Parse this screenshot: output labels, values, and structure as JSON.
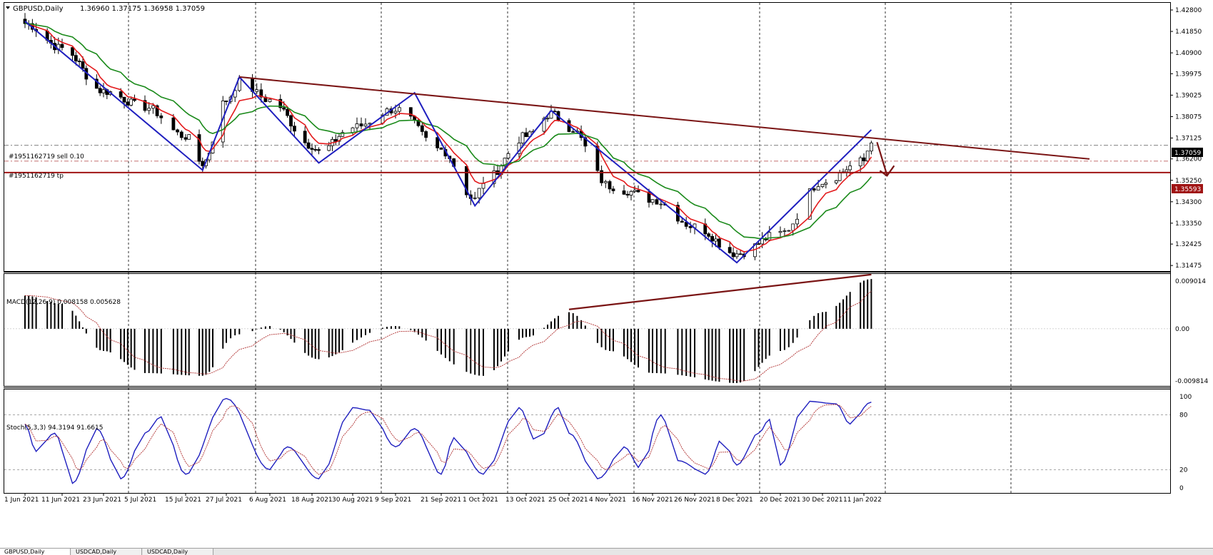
{
  "colors": {
    "candle_up": "#ffffff",
    "candle_down": "#000000",
    "ma_fast": "#e31a1c",
    "ma_slow": "#1a8a1a",
    "zigzag": "#1f1fbf",
    "trendline": "#7a1414",
    "support": "#a01414",
    "stoch_main": "#1f1fbf",
    "stoch_signal": "#b03030",
    "grid": "#000000"
  },
  "header": {
    "symbol_label": "GBPUSD,Daily",
    "ohlc_text": "1.36960 1.37175 1.36958 1.37059"
  },
  "orders": {
    "sell_label": "#1951162719 sell 0.10",
    "tp_label": "#1951162719 tp"
  },
  "price_tags": {
    "current": "1.37059",
    "support": "1.35593"
  },
  "price_axis_labels": [
    "1.42800",
    "1.41850",
    "1.40900",
    "1.39975",
    "1.39025",
    "1.38075",
    "1.37125",
    "1.36200",
    "1.35250",
    "1.34300",
    "1.33350",
    "1.32425",
    "1.31475"
  ],
  "macd": {
    "label": "MACD(12,26,9) 0.008158 0.005628",
    "axis_labels": [
      "0.009014",
      "0.00",
      "-0.009814"
    ]
  },
  "stoch": {
    "label": "Stoch(5,3,3) 94.3194 91.6615",
    "axis_labels": [
      "100",
      "80",
      "20",
      "0"
    ]
  },
  "date_labels": [
    "1 Jun 2021",
    "11 Jun 2021",
    "23 Jun 2021",
    "5 Jul 2021",
    "15 Jul 2021",
    "27 Jul 2021",
    "6 Aug 2021",
    "18 Aug 2021",
    "30 Aug 2021",
    "9 Sep 2021",
    "21 Sep 2021",
    "1 Oct 2021",
    "13 Oct 2021",
    "25 Oct 2021",
    "4 Nov 2021",
    "16 Nov 2021",
    "26 Nov 2021",
    "8 Dec 2021",
    "20 Dec 2021",
    "30 Dec 2021",
    "11 Jan 2022"
  ],
  "tabs": [
    "GBPUSD,Daily",
    "USDCAD,Daily",
    "USDCAD,Daily"
  ],
  "chart_data": {
    "type": "candlestick",
    "price_range": [
      1.3148,
      1.428
    ],
    "grid": true,
    "anchors": [
      {
        "date": "1 Jun 2021",
        "price": 1.422
      },
      {
        "date": "11 Jun 2021",
        "price": 1.411
      },
      {
        "date": "23 Jun 2021",
        "price": 1.392
      },
      {
        "date": "5 Jul 2021",
        "price": 1.385
      },
      {
        "date": "15 Jul 2021",
        "price": 1.372
      },
      {
        "date": "20 Jul 2021",
        "price": 1.36
      },
      {
        "date": "27 Jul 2021",
        "price": 1.388
      },
      {
        "date": "30 Jul 2021",
        "price": 1.396
      },
      {
        "date": "6 Aug 2021",
        "price": 1.388
      },
      {
        "date": "18 Aug 2021",
        "price": 1.368
      },
      {
        "date": "20 Aug 2021",
        "price": 1.365
      },
      {
        "date": "30 Aug 2021",
        "price": 1.376
      },
      {
        "date": "9 Sep 2021",
        "price": 1.384
      },
      {
        "date": "21 Sep 2021",
        "price": 1.366
      },
      {
        "date": "29 Sep 2021",
        "price": 1.344
      },
      {
        "date": "1 Oct 2021",
        "price": 1.352
      },
      {
        "date": "13 Oct 2021",
        "price": 1.372
      },
      {
        "date": "20 Oct 2021",
        "price": 1.382
      },
      {
        "date": "25 Oct 2021",
        "price": 1.376
      },
      {
        "date": "4 Nov 2021",
        "price": 1.35
      },
      {
        "date": "8 Nov 2021",
        "price": 1.348
      },
      {
        "date": "16 Nov 2021",
        "price": 1.344
      },
      {
        "date": "26 Nov 2021",
        "price": 1.332
      },
      {
        "date": "8 Dec 2021",
        "price": 1.32
      },
      {
        "date": "20 Dec 2021",
        "price": 1.329
      },
      {
        "date": "30 Dec 2021",
        "price": 1.352
      },
      {
        "date": "11 Jan 2022",
        "price": 1.361
      },
      {
        "date": "13 Jan 2022",
        "price": 1.3706
      }
    ],
    "zigzag": [
      {
        "date": "1 Jun 2021",
        "price": 1.423
      },
      {
        "date": "20 Jul 2021",
        "price": 1.357
      },
      {
        "date": "30 Jul 2021",
        "price": 1.3983
      },
      {
        "date": "20 Aug 2021",
        "price": 1.3602
      },
      {
        "date": "14 Sep 2021",
        "price": 1.3913
      },
      {
        "date": "29 Sep 2021",
        "price": 1.3412
      },
      {
        "date": "20 Oct 2021",
        "price": 1.3834
      },
      {
        "date": "8 Dec 2021",
        "price": 1.316
      },
      {
        "date": "13 Jan 2022",
        "price": 1.3749
      }
    ],
    "resistance_line": {
      "from": {
        "date": "30 Jul 2021",
        "price": 1.3983
      },
      "to": {
        "date": "13 Jan 2022",
        "price": 1.3713
      }
    },
    "support_level": 1.35593,
    "sell_level": 1.368,
    "tp_level": 1.361,
    "macd": {
      "range": [
        -0.009814,
        0.009014
      ],
      "anchors": [
        {
          "date": "1 Jun 2021",
          "value": 0.006
        },
        {
          "date": "11 Jun 2021",
          "value": 0.0045
        },
        {
          "date": "23 Jun 2021",
          "value": -0.004
        },
        {
          "date": "5 Jul 2021",
          "value": -0.008
        },
        {
          "date": "20 Jul 2021",
          "value": -0.0085
        },
        {
          "date": "30 Jul 2021",
          "value": -0.001
        },
        {
          "date": "6 Aug 2021",
          "value": 0.0005
        },
        {
          "date": "20 Aug 2021",
          "value": -0.0055
        },
        {
          "date": "9 Sep 2021",
          "value": 0.0005
        },
        {
          "date": "1 Oct 2021",
          "value": -0.0085
        },
        {
          "date": "13 Oct 2021",
          "value": -0.0015
        },
        {
          "date": "25 Oct 2021",
          "value": 0.003
        },
        {
          "date": "4 Nov 2021",
          "value": -0.004
        },
        {
          "date": "16 Nov 2021",
          "value": -0.008
        },
        {
          "date": "8 Dec 2021",
          "value": -0.0098
        },
        {
          "date": "20 Dec 2021",
          "value": -0.004
        },
        {
          "date": "30 Dec 2021",
          "value": 0.003
        },
        {
          "date": "13 Jan 2022",
          "value": 0.009
        }
      ],
      "divergence_line": {
        "from": {
          "date": "25 Oct 2021",
          "value": 0.0035
        },
        "to": {
          "date": "13 Jan 2022",
          "value": 0.0098
        }
      }
    },
    "stoch": {
      "range": [
        0,
        100
      ],
      "levels": [
        80,
        20
      ],
      "anchors": [
        {
          "date": "1 Jun 2021",
          "value": 70
        },
        {
          "date": "4 Jun 2021",
          "value": 40
        },
        {
          "date": "9 Jun 2021",
          "value": 60
        },
        {
          "date": "14 Jun 2021",
          "value": 5
        },
        {
          "date": "21 Jun 2021",
          "value": 65
        },
        {
          "date": "28 Jun 2021",
          "value": 10
        },
        {
          "date": "5 Jul 2021",
          "value": 60
        },
        {
          "date": "9 Jul 2021",
          "value": 78
        },
        {
          "date": "15 Jul 2021",
          "value": 15
        },
        {
          "date": "27 Jul 2021",
          "value": 98
        },
        {
          "date": "6 Aug 2021",
          "value": 20
        },
        {
          "date": "11 Aug 2021",
          "value": 45
        },
        {
          "date": "20 Aug 2021",
          "value": 10
        },
        {
          "date": "30 Aug 2021",
          "value": 88
        },
        {
          "date": "3 Sep 2021",
          "value": 85
        },
        {
          "date": "9 Sep 2021",
          "value": 45
        },
        {
          "date": "14 Sep 2021",
          "value": 65
        },
        {
          "date": "21 Sep 2021",
          "value": 15
        },
        {
          "date": "24 Sep 2021",
          "value": 55
        },
        {
          "date": "1 Oct 2021",
          "value": 15
        },
        {
          "date": "11 Oct 2021",
          "value": 88
        },
        {
          "date": "16 Oct 2021",
          "value": 50
        },
        {
          "date": "22 Oct 2021",
          "value": 88
        },
        {
          "date": "25 Oct 2021",
          "value": 60
        },
        {
          "date": "1 Nov 2021",
          "value": 10
        },
        {
          "date": "8 Nov 2021",
          "value": 45
        },
        {
          "date": "13 Nov 2021",
          "value": 20
        },
        {
          "date": "18 Nov 2021",
          "value": 80
        },
        {
          "date": "22 Nov 2021",
          "value": 30
        },
        {
          "date": "29 Nov 2021",
          "value": 15
        },
        {
          "date": "4 Dec 2021",
          "value": 55
        },
        {
          "date": "8 Dec 2021",
          "value": 25
        },
        {
          "date": "14 Dec 2021",
          "value": 60
        },
        {
          "date": "17 Dec 2021",
          "value": 75
        },
        {
          "date": "20 Dec 2021",
          "value": 25
        },
        {
          "date": "26 Dec 2021",
          "value": 95
        },
        {
          "date": "3 Jan 2022",
          "value": 92
        },
        {
          "date": "7 Jan 2022",
          "value": 70
        },
        {
          "date": "13 Jan 2022",
          "value": 94
        }
      ]
    }
  }
}
